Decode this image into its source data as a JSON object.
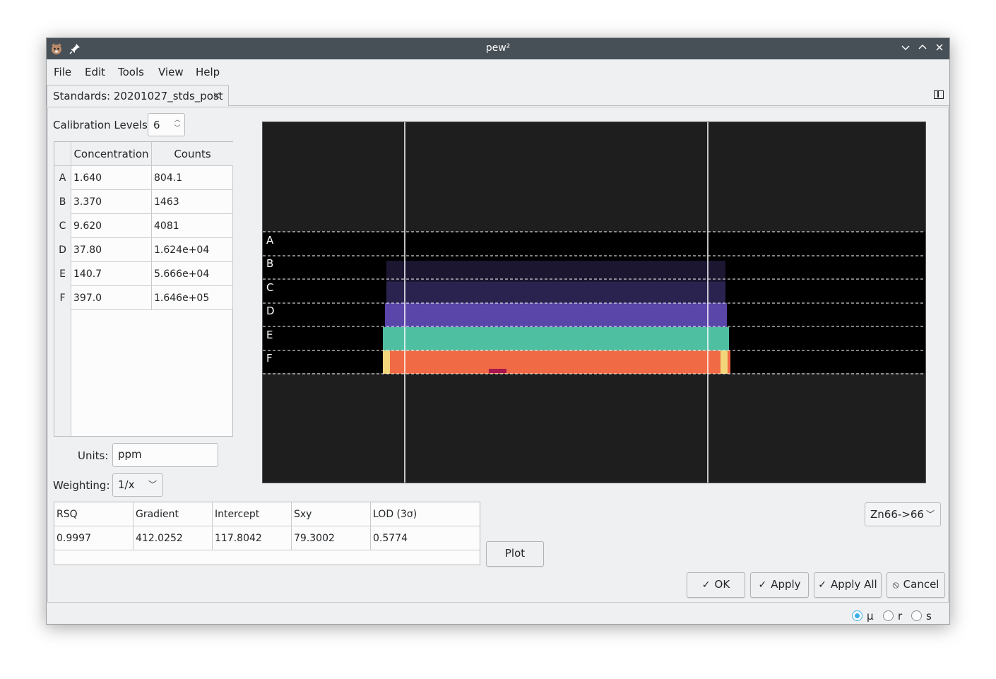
{
  "window": {
    "title": "pew²"
  },
  "menu": [
    "File",
    "Edit",
    "Tools",
    "View",
    "Help"
  ],
  "tab": {
    "label": "Standards: 20201027_stds_post",
    "close": "×"
  },
  "calibration": {
    "label": "Calibration Levels:",
    "value": "6"
  },
  "table": {
    "headers": [
      "Concentration",
      "Counts"
    ],
    "rows": [
      {
        "level": "A",
        "concentration": "1.640",
        "counts": "804.1"
      },
      {
        "level": "B",
        "concentration": "3.370",
        "counts": "1463"
      },
      {
        "level": "C",
        "concentration": "9.620",
        "counts": "4081"
      },
      {
        "level": "D",
        "concentration": "37.80",
        "counts": "1.624e+04"
      },
      {
        "level": "E",
        "concentration": "140.7",
        "counts": "5.666e+04"
      },
      {
        "level": "F",
        "concentration": "397.0",
        "counts": "1.646e+05"
      }
    ]
  },
  "units": {
    "label": "Units:",
    "value": "ppm"
  },
  "weighting": {
    "label": "Weighting:",
    "value": "1/x"
  },
  "results": {
    "headers": [
      "RSQ",
      "Gradient",
      "Intercept",
      "Sxy",
      "LOD (3σ)"
    ],
    "values": [
      "0.9997",
      "412.0252",
      "117.8042",
      "79.3002",
      "0.5774"
    ]
  },
  "plot": {
    "levels": [
      "A",
      "B",
      "C",
      "D",
      "E",
      "F"
    ]
  },
  "isotope": {
    "value": "Zn66->66"
  },
  "buttons": {
    "plot": "Plot",
    "ok": "OK",
    "apply": "Apply",
    "apply_all": "Apply All",
    "cancel": "Cancel"
  },
  "status": {
    "options": [
      "μ",
      "r",
      "s"
    ],
    "selected": "μ"
  },
  "colors": {
    "titlebar": "#475057",
    "accent": "#3daee9",
    "plot_bg": "#1e1e1e",
    "band_d": "#5a45a8",
    "band_e": "#4fbfa2",
    "band_f": "#f06a45"
  }
}
